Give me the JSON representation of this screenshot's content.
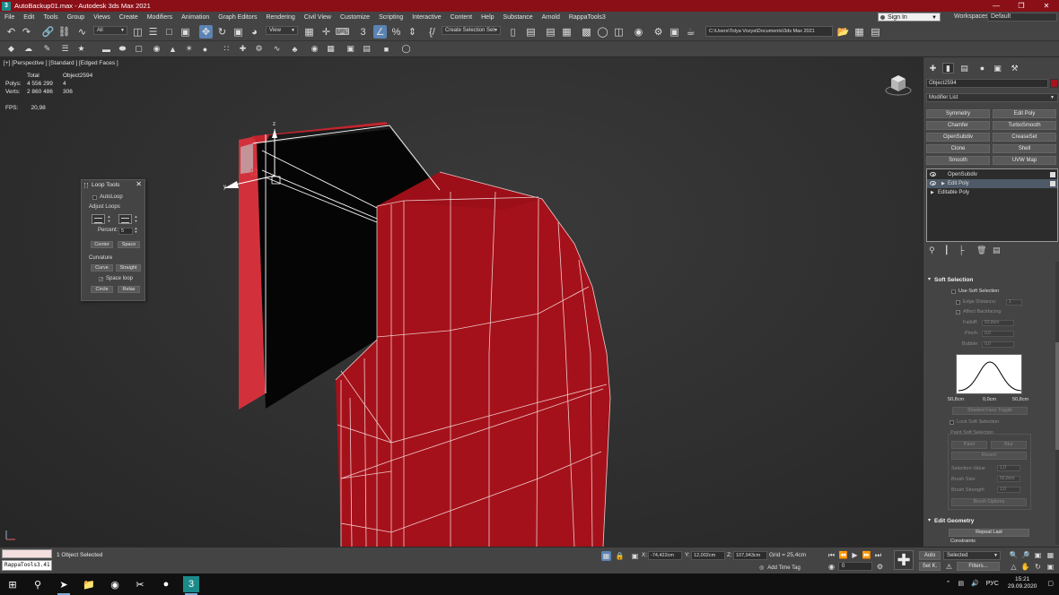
{
  "window": {
    "title": "AutoBackup01.max - Autodesk 3ds Max 2021",
    "app_icon": "3",
    "controls": [
      "—",
      "❐",
      "✕"
    ]
  },
  "menu": {
    "items": [
      "File",
      "Edit",
      "Tools",
      "Group",
      "Views",
      "Create",
      "Modifiers",
      "Animation",
      "Graph Editors",
      "Rendering",
      "Civil View",
      "Customize",
      "Scripting",
      "Interactive",
      "Content",
      "Help",
      "Substance",
      "Arnold",
      "RappaTools3"
    ],
    "sign_in": "Sign In",
    "workspaces_label": "Workspaces:",
    "workspace_value": "Default"
  },
  "toolbar": {
    "selection_filter": "All",
    "ref_coord": "View",
    "create_selection_set": "Create Selection Set",
    "project_path": "C:\\Users\\Tolya Vozya\\Documents\\3ds Max 2021"
  },
  "viewport": {
    "label": "[+] [Perspective ] [Standard ] [Edged Faces ]",
    "stats_header_total": "Total",
    "stats_header_object": "Object2594",
    "polys_label": "Polys:",
    "polys_total": "4 556 299",
    "polys_object": "4",
    "verts_label": "Verts:",
    "verts_total": "2 860 486",
    "verts_object": "306",
    "fps_label": "FPS:",
    "fps_value": "20,98",
    "gizmo_z": "z",
    "gizmo_y": "y",
    "corner_axes": "z x"
  },
  "looptools": {
    "title": "Loop Tools",
    "autoloop": "AutoLoop",
    "adjust_loops": "Adjust Loops",
    "percent_label": "Percent:",
    "percent_value": "5",
    "center": "Center",
    "space": "Space",
    "curvature": "Curvature",
    "curve": "Curve",
    "straight": "Straight",
    "space_loop": "Space loop",
    "circle": "Circle",
    "relax": "Relax"
  },
  "command_panel": {
    "object_name": "Object2594",
    "object_color": "#a8121b",
    "modifier_list": "Modifier List",
    "modifier_buttons": [
      "Symmetry",
      "Edit Poly",
      "Chamfer",
      "TurboSmooth",
      "OpenSubdiv",
      "CreaseSet",
      "Clone",
      "Shell",
      "Smooth",
      "UVW Map"
    ],
    "stack": [
      {
        "label": "OpenSubdiv",
        "eye": true,
        "selected": false
      },
      {
        "label": "Edit Poly",
        "eye": true,
        "selected": true
      },
      {
        "label": "Editable Poly",
        "eye": false,
        "selected": false
      }
    ],
    "soft_selection": {
      "header": "Soft Selection",
      "use_soft_selection": "Use Soft Selection",
      "edge_distance": "Edge Distance:",
      "edge_distance_value": "1",
      "affect_backfacing": "Affect Backfacing",
      "falloff_label": "Falloff:",
      "falloff_value": "50,8cm",
      "pinch_label": "Pinch:",
      "pinch_value": "0,0",
      "bubble_label": "Bubble:",
      "bubble_value": "0,0",
      "curve_left": "50,8cm",
      "curve_mid": "0,0cm",
      "curve_right": "50,8cm",
      "shaded_face_toggle": "Shaded Face Toggle",
      "lock_soft_selection": "Lock Soft Selection",
      "paint_soft_selection": "Paint Soft Selection",
      "paint": "Paint",
      "blur": "Blur",
      "revert": "Revert",
      "selection_value_label": "Selection Value",
      "selection_value": "1,0",
      "brush_size_label": "Brush Size",
      "brush_size": "50,8cm",
      "brush_strength_label": "Brush Strength",
      "brush_strength": "1,0",
      "brush_options": "Brush Options"
    },
    "edit_geometry": {
      "header": "Edit Geometry",
      "repeat_last": "Repeat Last",
      "constraints": "Constraints"
    }
  },
  "status": {
    "rappa_field": "RappaTools3.41",
    "selection": "1 Object Selected",
    "x_label": "X:",
    "x_value": "-74,422cm",
    "y_label": "Y:",
    "y_value": "12,002cm",
    "z_label": "Z:",
    "z_value": "107,943cm",
    "grid": "Grid = 25,4cm",
    "add_time_tag": "Add Time Tag",
    "frame": "0",
    "auto": "Auto",
    "set_k": "Set K.",
    "key_mode": "Selected",
    "filters": "Filters..."
  },
  "taskbar": {
    "language": "РУС",
    "time": "15:21",
    "date": "29.09.2020"
  }
}
